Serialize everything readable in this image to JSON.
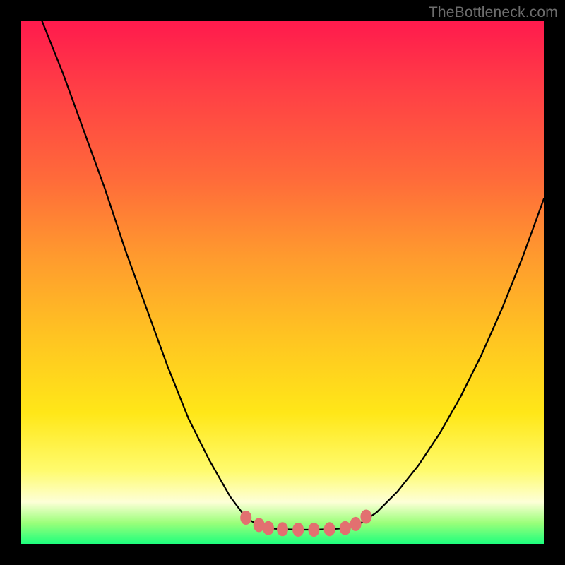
{
  "watermark": "TheBottleneck.com",
  "chart_data": {
    "type": "line",
    "title": "",
    "xlabel": "",
    "ylabel": "",
    "xlim": [
      0,
      100
    ],
    "ylim": [
      0,
      100
    ],
    "grid": false,
    "legend": false,
    "series": [
      {
        "name": "left-curve",
        "x": [
          4,
          8,
          12,
          16,
          20,
          24,
          28,
          32,
          36,
          40,
          43,
          45.5,
          47
        ],
        "y": [
          100,
          90,
          79,
          68,
          56,
          45,
          34,
          24,
          16,
          9,
          5,
          3.5,
          3
        ]
      },
      {
        "name": "bottom-flat",
        "x": [
          47,
          50,
          53,
          56,
          59,
          62
        ],
        "y": [
          3,
          2.8,
          2.7,
          2.7,
          2.8,
          3
        ]
      },
      {
        "name": "right-curve",
        "x": [
          62,
          65,
          68,
          72,
          76,
          80,
          84,
          88,
          92,
          96,
          100
        ],
        "y": [
          3,
          4,
          6,
          10,
          15,
          21,
          28,
          36,
          45,
          55,
          66
        ]
      }
    ],
    "markers": {
      "name": "bottom-dots",
      "color": "#e27070",
      "points": [
        {
          "x": 43,
          "y": 5.0
        },
        {
          "x": 45.5,
          "y": 3.6
        },
        {
          "x": 47.3,
          "y": 3.0
        },
        {
          "x": 50,
          "y": 2.8
        },
        {
          "x": 53,
          "y": 2.7
        },
        {
          "x": 56,
          "y": 2.7
        },
        {
          "x": 59,
          "y": 2.8
        },
        {
          "x": 62,
          "y": 3.0
        },
        {
          "x": 64,
          "y": 3.8
        },
        {
          "x": 66,
          "y": 5.2
        }
      ]
    },
    "background_gradient": {
      "top": "#ff1a4d",
      "mid": "#ffe718",
      "bottom": "#1eff7d"
    }
  }
}
